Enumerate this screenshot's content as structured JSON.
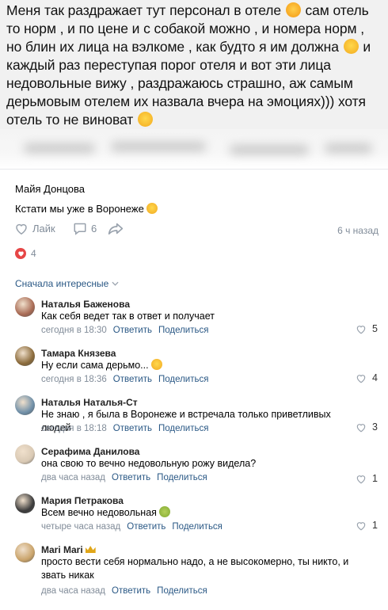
{
  "post_quote": {
    "part1": "Меня так раздражает тут персонал в отеле",
    "emoji1": "angry-face-emoji",
    "part2": " сам отель то норм , и по цене и с собакой можно , и номера норм , но блин их лица на вэлкоме , как будто я им должна",
    "emoji2": "grinning-face-emoji",
    "part3": " и каждый раз переступая порог отеля и вот эти лица недовольные вижу , раздражаюсь страшно, аж самым дерьмовым отелем их назвала вчера на эмоциях))) хотя отель то не виноват",
    "emoji3": "tears-of-joy-emoji"
  },
  "post": {
    "author": "Майя Донцова",
    "text": "Кстати мы уже в Воронеже",
    "text_emoji": "grinning-face-emoji",
    "like_label": "Лайк",
    "comments_count": "6",
    "time": "6 ч назад",
    "likes_count": "4"
  },
  "sort_label": "Сначала интересные",
  "comments": [
    {
      "name": "Наталья Баженова",
      "text": "Как себя ведет так в ответ и получает",
      "time": "сегодня в 18:30",
      "reply": "Ответить",
      "share": "Поделиться",
      "likes": "5",
      "avatar_color": "#a86a54"
    },
    {
      "name": "Тамара Князева",
      "text": "Ну если сама дерьмо...",
      "time": "сегодня в 18:36",
      "reply": "Ответить",
      "share": "Поделиться",
      "likes": "4",
      "avatar_color": "#8a6a3a"
    },
    {
      "name": "Наталья Наталья-Ст",
      "text": "Не знаю , я была в Воронеже и встречала только приветливых людей",
      "time": "сегодня в 18:18",
      "reply": "Ответить",
      "share": "Поделиться",
      "likes": "3",
      "avatar_color": "#6f8fa8"
    },
    {
      "name": "Серафима Данилова",
      "text": "она свою то вечно недовольную рожу видела?",
      "time": "два часа назад",
      "reply": "Ответить",
      "share": "Поделиться",
      "likes": "1",
      "avatar_color": "#d9c9b4"
    },
    {
      "name": "Мария Петракова",
      "text": "Всем вечно недовольная",
      "time": "четыре часа назад",
      "reply": "Ответить",
      "share": "Поделиться",
      "likes": "1",
      "avatar_color": "#3b3b3b"
    },
    {
      "name": "Mari Mari",
      "text": "просто вести себя нормально надо, а не высокомерно, ты никто, и звать никак",
      "time": "два часа назад",
      "reply": "Ответить",
      "share": "Поделиться",
      "likes": "",
      "avatar_color": "#c9a36a"
    }
  ]
}
